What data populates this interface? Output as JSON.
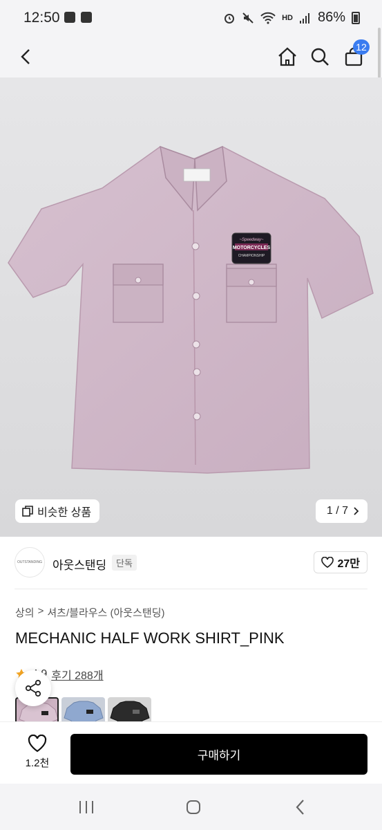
{
  "status_bar": {
    "time": "12:50",
    "battery": "86%",
    "network": "HD"
  },
  "header": {
    "cart_count": "12"
  },
  "gallery": {
    "similar_label": "비슷한 상품",
    "counter": "1 / 7",
    "patch_line1": "MOTORCYCLES",
    "patch_line2": "CHAMPIONSHIP",
    "shirt_color": "#cfb7c7"
  },
  "brand": {
    "logo_text": "OUTSTANDING",
    "name": "아웃스탠딩",
    "badge": "단독",
    "likes": "27만"
  },
  "breadcrumb": {
    "level1": "상의",
    "separator": ">",
    "level2": "셔츠/블라우스 (아웃스탠딩)"
  },
  "product": {
    "title": "MECHANIC HALF WORK SHIRT_PINK",
    "rating": "4.9",
    "reviews": "후기 288개"
  },
  "color_options": [
    {
      "name": "pink",
      "color": "#cdb3c3"
    },
    {
      "name": "blue",
      "color": "#8fa8cf"
    },
    {
      "name": "black",
      "color": "#2b2b2b"
    }
  ],
  "bottom_bar": {
    "wish_count": "1.2천",
    "buy_label": "구매하기"
  },
  "colors": {
    "accent": "#3a7cf0",
    "buy_button": "#000000",
    "star": "#f5a623"
  }
}
